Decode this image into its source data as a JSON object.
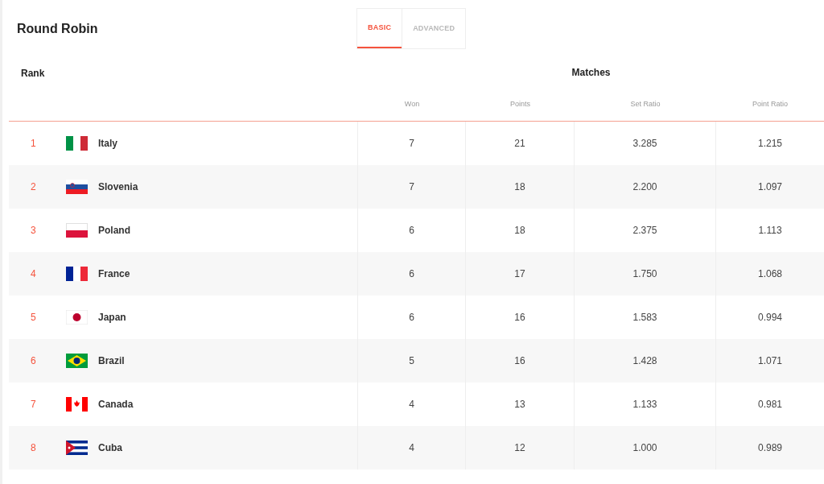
{
  "title": "Round Robin",
  "tabs": [
    {
      "label": "BASIC",
      "selected": true
    },
    {
      "label": "ADVANCED",
      "selected": false
    }
  ],
  "table": {
    "rank_header": "Rank",
    "group_header": "Matches",
    "columns": [
      "Won",
      "Points",
      "Set Ratio",
      "Point Ratio"
    ],
    "rows": [
      {
        "rank": "1",
        "kind": "italy",
        "team": "Italy",
        "values": [
          "7",
          "21",
          "3.285",
          "1.215"
        ]
      },
      {
        "rank": "2",
        "kind": "slovenia",
        "team": "Slovenia",
        "values": [
          "7",
          "18",
          "2.200",
          "1.097"
        ]
      },
      {
        "rank": "3",
        "kind": "poland",
        "team": "Poland",
        "values": [
          "6",
          "18",
          "2.375",
          "1.113"
        ]
      },
      {
        "rank": "4",
        "kind": "france",
        "team": "France",
        "values": [
          "6",
          "17",
          "1.750",
          "1.068"
        ]
      },
      {
        "rank": "5",
        "kind": "japan",
        "team": "Japan",
        "values": [
          "6",
          "16",
          "1.583",
          "0.994"
        ]
      },
      {
        "rank": "6",
        "kind": "brazil",
        "team": "Brazil",
        "values": [
          "5",
          "16",
          "1.428",
          "1.071"
        ]
      },
      {
        "rank": "7",
        "kind": "canada",
        "team": "Canada",
        "values": [
          "4",
          "13",
          "1.133",
          "0.981"
        ]
      },
      {
        "rank": "8",
        "kind": "cuba",
        "team": "Cuba",
        "values": [
          "4",
          "12",
          "1.000",
          "0.989"
        ]
      }
    ]
  }
}
